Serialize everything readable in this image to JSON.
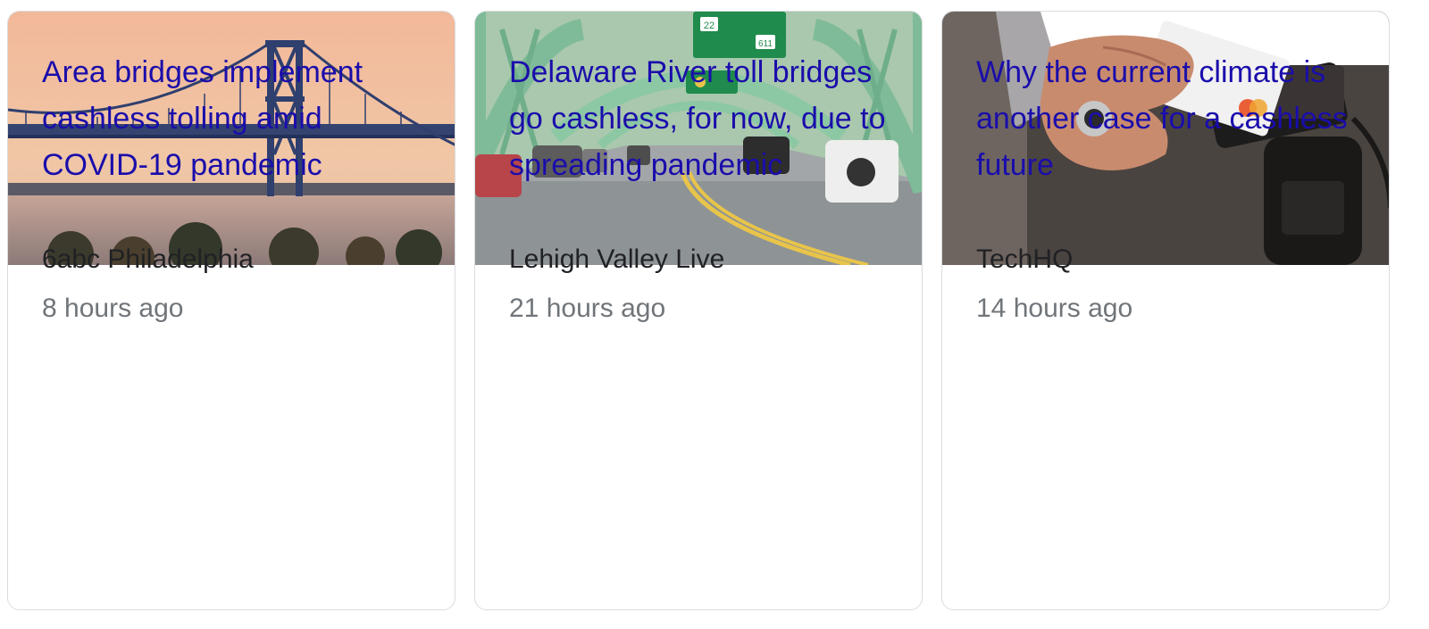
{
  "cards": [
    {
      "headline": "Area bridges implement cashless tolling amid COVID-19 pandemic",
      "source": "6abc Philadelphia",
      "time": "8 hours ago",
      "image": "bridge-sunset-photo"
    },
    {
      "headline": "Delaware River toll bridges go cashless, for now, due to spreading pandemic",
      "source": "Lehigh Valley Live",
      "time": "21 hours ago",
      "image": "green-truss-bridge-road-photo",
      "signs": [
        "22",
        "611"
      ]
    },
    {
      "headline": "Why the current climate is another case for a cashless future",
      "source": "TechHQ",
      "time": "14 hours ago",
      "image": "hand-card-payment-photo"
    }
  ],
  "colors": {
    "headline": "#1a0dab",
    "source": "#202124",
    "time": "#70757a",
    "border": "#dadce0"
  }
}
